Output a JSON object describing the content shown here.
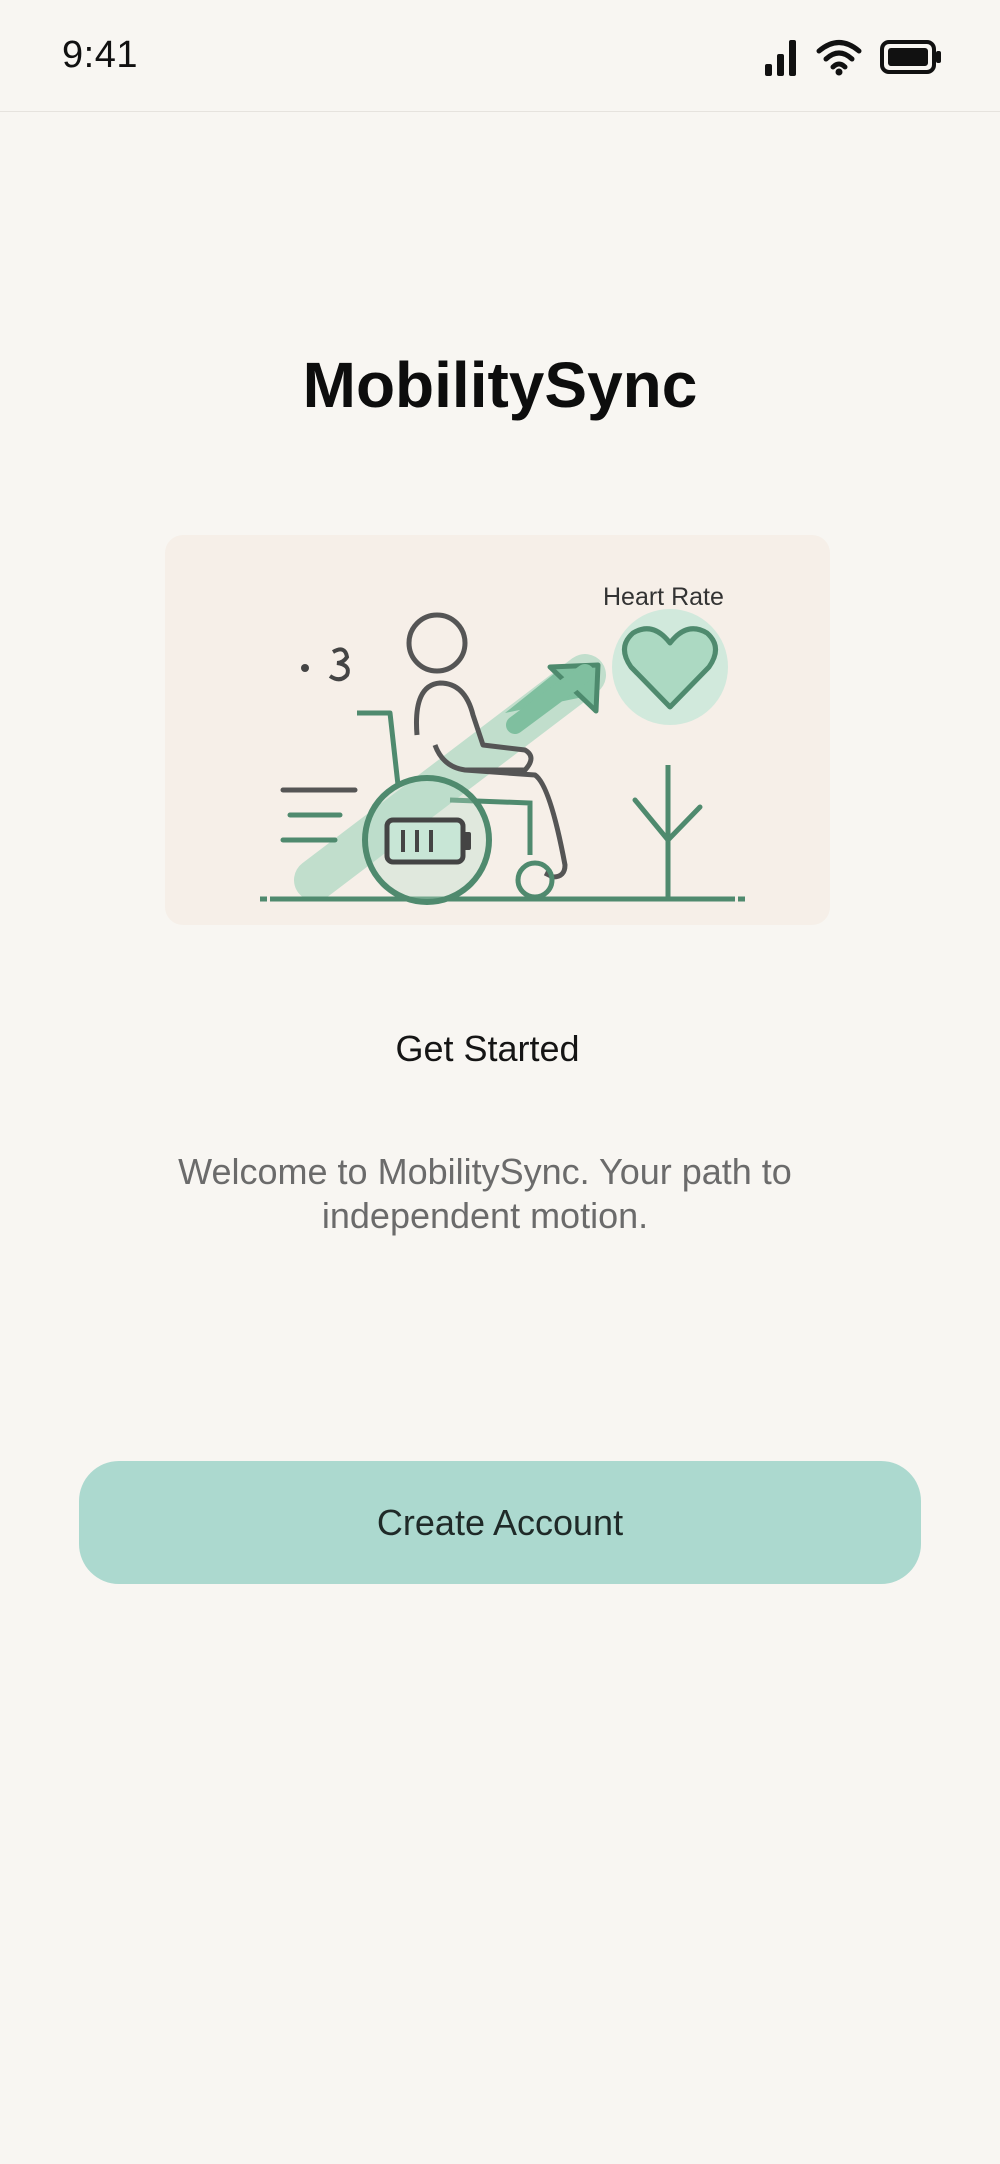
{
  "status_bar": {
    "time": "9:41",
    "signal_icon": "cellular-signal-icon",
    "wifi_icon": "wifi-icon",
    "battery_icon": "battery-icon"
  },
  "app": {
    "title": "MobilitySync"
  },
  "illustration": {
    "label": "Heart Rate",
    "icons": [
      "wheelchair-user-icon",
      "heart-icon",
      "battery-icon",
      "up-arrow-icon",
      "plant-icon"
    ]
  },
  "onboarding": {
    "subtitle": "Get Started",
    "description": "Welcome to MobilitySync. Your path to independent motion."
  },
  "actions": {
    "create_account_label": "Create Account"
  },
  "colors": {
    "background": "#f8f6f2",
    "accent": "#acd9cf",
    "illustration_green": "#5f9e7f"
  }
}
